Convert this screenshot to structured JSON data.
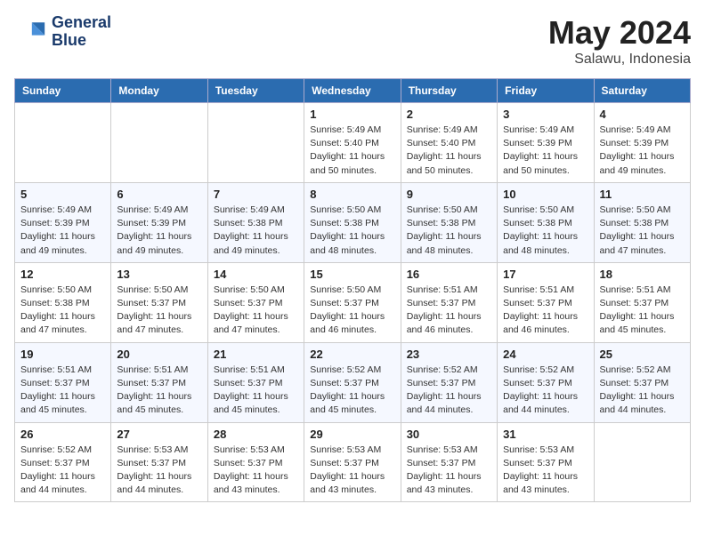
{
  "logo": {
    "line1": "General",
    "line2": "Blue"
  },
  "title": {
    "month_year": "May 2024",
    "location": "Salawu, Indonesia"
  },
  "weekdays": [
    "Sunday",
    "Monday",
    "Tuesday",
    "Wednesday",
    "Thursday",
    "Friday",
    "Saturday"
  ],
  "weeks": [
    [
      {
        "day": "",
        "sunrise": "",
        "sunset": "",
        "daylight": ""
      },
      {
        "day": "",
        "sunrise": "",
        "sunset": "",
        "daylight": ""
      },
      {
        "day": "",
        "sunrise": "",
        "sunset": "",
        "daylight": ""
      },
      {
        "day": "1",
        "sunrise": "Sunrise: 5:49 AM",
        "sunset": "Sunset: 5:40 PM",
        "daylight": "Daylight: 11 hours and 50 minutes."
      },
      {
        "day": "2",
        "sunrise": "Sunrise: 5:49 AM",
        "sunset": "Sunset: 5:40 PM",
        "daylight": "Daylight: 11 hours and 50 minutes."
      },
      {
        "day": "3",
        "sunrise": "Sunrise: 5:49 AM",
        "sunset": "Sunset: 5:39 PM",
        "daylight": "Daylight: 11 hours and 50 minutes."
      },
      {
        "day": "4",
        "sunrise": "Sunrise: 5:49 AM",
        "sunset": "Sunset: 5:39 PM",
        "daylight": "Daylight: 11 hours and 49 minutes."
      }
    ],
    [
      {
        "day": "5",
        "sunrise": "Sunrise: 5:49 AM",
        "sunset": "Sunset: 5:39 PM",
        "daylight": "Daylight: 11 hours and 49 minutes."
      },
      {
        "day": "6",
        "sunrise": "Sunrise: 5:49 AM",
        "sunset": "Sunset: 5:39 PM",
        "daylight": "Daylight: 11 hours and 49 minutes."
      },
      {
        "day": "7",
        "sunrise": "Sunrise: 5:49 AM",
        "sunset": "Sunset: 5:38 PM",
        "daylight": "Daylight: 11 hours and 49 minutes."
      },
      {
        "day": "8",
        "sunrise": "Sunrise: 5:50 AM",
        "sunset": "Sunset: 5:38 PM",
        "daylight": "Daylight: 11 hours and 48 minutes."
      },
      {
        "day": "9",
        "sunrise": "Sunrise: 5:50 AM",
        "sunset": "Sunset: 5:38 PM",
        "daylight": "Daylight: 11 hours and 48 minutes."
      },
      {
        "day": "10",
        "sunrise": "Sunrise: 5:50 AM",
        "sunset": "Sunset: 5:38 PM",
        "daylight": "Daylight: 11 hours and 48 minutes."
      },
      {
        "day": "11",
        "sunrise": "Sunrise: 5:50 AM",
        "sunset": "Sunset: 5:38 PM",
        "daylight": "Daylight: 11 hours and 47 minutes."
      }
    ],
    [
      {
        "day": "12",
        "sunrise": "Sunrise: 5:50 AM",
        "sunset": "Sunset: 5:38 PM",
        "daylight": "Daylight: 11 hours and 47 minutes."
      },
      {
        "day": "13",
        "sunrise": "Sunrise: 5:50 AM",
        "sunset": "Sunset: 5:37 PM",
        "daylight": "Daylight: 11 hours and 47 minutes."
      },
      {
        "day": "14",
        "sunrise": "Sunrise: 5:50 AM",
        "sunset": "Sunset: 5:37 PM",
        "daylight": "Daylight: 11 hours and 47 minutes."
      },
      {
        "day": "15",
        "sunrise": "Sunrise: 5:50 AM",
        "sunset": "Sunset: 5:37 PM",
        "daylight": "Daylight: 11 hours and 46 minutes."
      },
      {
        "day": "16",
        "sunrise": "Sunrise: 5:51 AM",
        "sunset": "Sunset: 5:37 PM",
        "daylight": "Daylight: 11 hours and 46 minutes."
      },
      {
        "day": "17",
        "sunrise": "Sunrise: 5:51 AM",
        "sunset": "Sunset: 5:37 PM",
        "daylight": "Daylight: 11 hours and 46 minutes."
      },
      {
        "day": "18",
        "sunrise": "Sunrise: 5:51 AM",
        "sunset": "Sunset: 5:37 PM",
        "daylight": "Daylight: 11 hours and 45 minutes."
      }
    ],
    [
      {
        "day": "19",
        "sunrise": "Sunrise: 5:51 AM",
        "sunset": "Sunset: 5:37 PM",
        "daylight": "Daylight: 11 hours and 45 minutes."
      },
      {
        "day": "20",
        "sunrise": "Sunrise: 5:51 AM",
        "sunset": "Sunset: 5:37 PM",
        "daylight": "Daylight: 11 hours and 45 minutes."
      },
      {
        "day": "21",
        "sunrise": "Sunrise: 5:51 AM",
        "sunset": "Sunset: 5:37 PM",
        "daylight": "Daylight: 11 hours and 45 minutes."
      },
      {
        "day": "22",
        "sunrise": "Sunrise: 5:52 AM",
        "sunset": "Sunset: 5:37 PM",
        "daylight": "Daylight: 11 hours and 45 minutes."
      },
      {
        "day": "23",
        "sunrise": "Sunrise: 5:52 AM",
        "sunset": "Sunset: 5:37 PM",
        "daylight": "Daylight: 11 hours and 44 minutes."
      },
      {
        "day": "24",
        "sunrise": "Sunrise: 5:52 AM",
        "sunset": "Sunset: 5:37 PM",
        "daylight": "Daylight: 11 hours and 44 minutes."
      },
      {
        "day": "25",
        "sunrise": "Sunrise: 5:52 AM",
        "sunset": "Sunset: 5:37 PM",
        "daylight": "Daylight: 11 hours and 44 minutes."
      }
    ],
    [
      {
        "day": "26",
        "sunrise": "Sunrise: 5:52 AM",
        "sunset": "Sunset: 5:37 PM",
        "daylight": "Daylight: 11 hours and 44 minutes."
      },
      {
        "day": "27",
        "sunrise": "Sunrise: 5:53 AM",
        "sunset": "Sunset: 5:37 PM",
        "daylight": "Daylight: 11 hours and 44 minutes."
      },
      {
        "day": "28",
        "sunrise": "Sunrise: 5:53 AM",
        "sunset": "Sunset: 5:37 PM",
        "daylight": "Daylight: 11 hours and 43 minutes."
      },
      {
        "day": "29",
        "sunrise": "Sunrise: 5:53 AM",
        "sunset": "Sunset: 5:37 PM",
        "daylight": "Daylight: 11 hours and 43 minutes."
      },
      {
        "day": "30",
        "sunrise": "Sunrise: 5:53 AM",
        "sunset": "Sunset: 5:37 PM",
        "daylight": "Daylight: 11 hours and 43 minutes."
      },
      {
        "day": "31",
        "sunrise": "Sunrise: 5:53 AM",
        "sunset": "Sunset: 5:37 PM",
        "daylight": "Daylight: 11 hours and 43 minutes."
      },
      {
        "day": "",
        "sunrise": "",
        "sunset": "",
        "daylight": ""
      }
    ]
  ]
}
